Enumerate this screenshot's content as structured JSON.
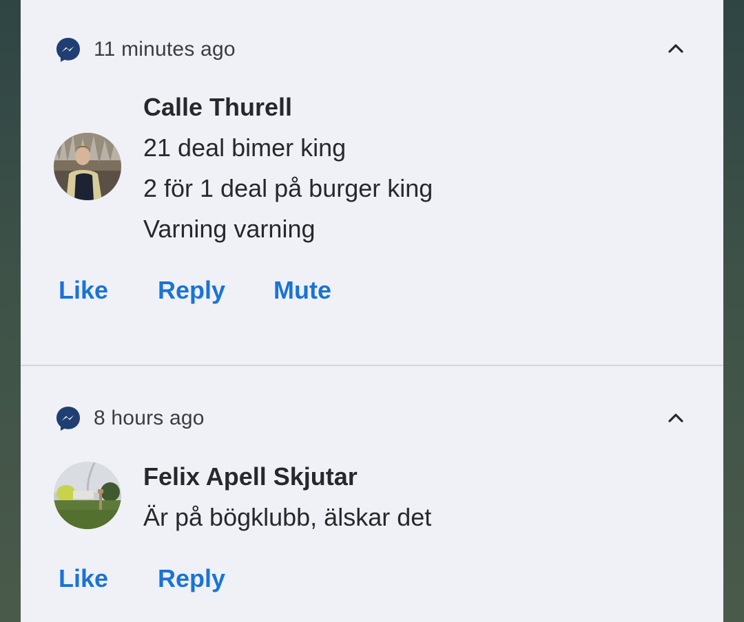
{
  "notifications": [
    {
      "app_icon": "messenger-icon",
      "time": "11 minutes ago",
      "expand_icon": "chevron-up-icon",
      "sender": "Calle Thurell",
      "messages": [
        "21 deal bimer king",
        "2 för 1 deal på burger king",
        "Varning varning"
      ],
      "actions": [
        "Like",
        "Reply",
        "Mute"
      ]
    },
    {
      "app_icon": "messenger-icon",
      "time": "8 hours ago",
      "expand_icon": "chevron-up-icon",
      "sender": "Felix Apell Skjutar",
      "messages": [
        "Är på bögklubb, älskar det"
      ],
      "actions": [
        "Like",
        "Reply"
      ]
    }
  ],
  "colors": {
    "panel_background": "#eff1f6",
    "action_text": "#1a73d6",
    "primary_text": "#26282b",
    "messenger_icon": "#1f3f73"
  }
}
